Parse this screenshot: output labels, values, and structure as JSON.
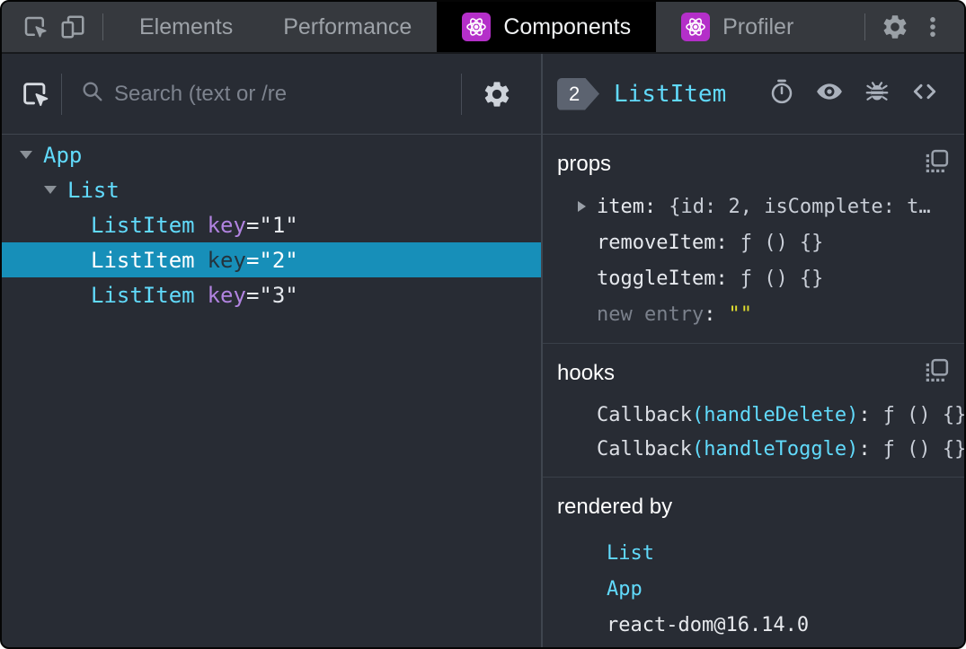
{
  "colors": {
    "accent_cyan": "#61dafb",
    "selected_row_bg": "#178fb9",
    "react_icon_purple": "#b42fc9",
    "key_attr_purple": "#b183e0",
    "string_yellow": "#e3df2e",
    "panel_bg": "#282c34",
    "tabbar_bg": "#36393e"
  },
  "tabbar": {
    "icons": {
      "left1": "inspect-cursor",
      "left2": "device-toolbar",
      "right1": "gear",
      "right2": "kebab-menu"
    },
    "tabs": [
      {
        "label": "Elements",
        "active": false
      },
      {
        "label": "Performance",
        "active": false
      },
      {
        "label": "Components",
        "active": true,
        "icon": "react-logo"
      },
      {
        "label": "Profiler",
        "active": false,
        "icon": "react-logo"
      }
    ]
  },
  "left_panel": {
    "toolbar": {
      "picker_icon": "inspect-cursor",
      "search_icon": "magnifier",
      "settings_icon": "gear",
      "search_placeholder": "Search (text or /re"
    },
    "tree": [
      {
        "name": "App",
        "expanded": true
      },
      {
        "name": "List",
        "expanded": true
      },
      {
        "name": "ListItem",
        "key_name": "key",
        "key_value": "=\"1\"",
        "selected": false
      },
      {
        "name": "ListItem",
        "key_name": "key",
        "key_value": "=\"2\"",
        "selected": true
      },
      {
        "name": "ListItem",
        "key_name": "key",
        "key_value": "=\"3\"",
        "selected": false
      }
    ]
  },
  "right_panel": {
    "header": {
      "badge": "2",
      "component": "ListItem",
      "icons": [
        "stopwatch",
        "eye",
        "bug",
        "code-brackets"
      ]
    },
    "props": {
      "title": "props",
      "copy_icon": "copy",
      "rows": [
        {
          "name": "item",
          "sep": ":",
          "value": "{id: 2, isComplete: t…"
        },
        {
          "name": "removeItem",
          "sep": ":",
          "value": "ƒ () {}"
        },
        {
          "name": "toggleItem",
          "sep": ":",
          "value": "ƒ () {}"
        }
      ],
      "new_entry": {
        "name": "new entry",
        "sep": ":",
        "value": "\"\""
      }
    },
    "hooks": {
      "title": "hooks",
      "copy_icon": "copy",
      "rows": [
        {
          "name": "Callback",
          "paren": "(handleDelete)",
          "sep": ":",
          "value": "ƒ () {}"
        },
        {
          "name": "Callback",
          "paren": "(handleToggle)",
          "sep": ":",
          "value": "ƒ () {}"
        }
      ]
    },
    "rendered_by": {
      "title": "rendered by",
      "items": [
        {
          "label": "List",
          "link": true
        },
        {
          "label": "App",
          "link": true
        },
        {
          "label": "react-dom@16.14.0",
          "link": false
        }
      ]
    }
  }
}
